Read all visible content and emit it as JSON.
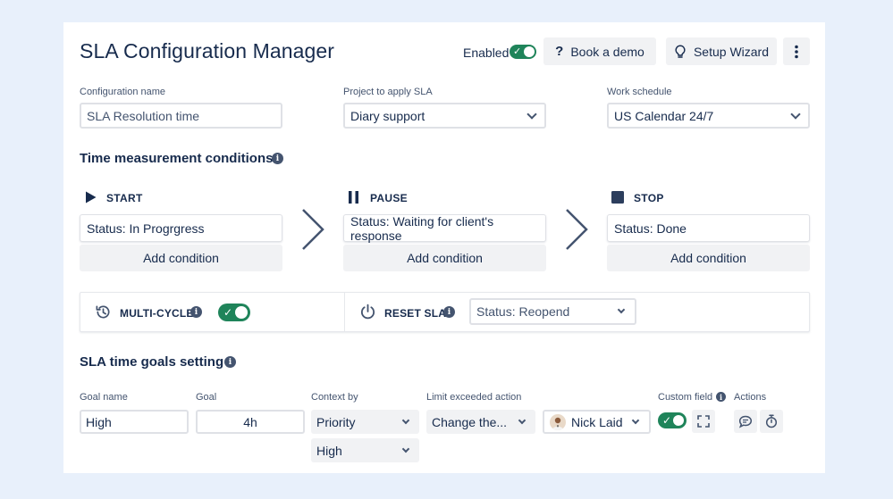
{
  "header": {
    "title": "SLA Configuration Manager",
    "enabled_label": "Enabled",
    "enabled": true,
    "book_demo": "Book a demo",
    "setup_wizard": "Setup Wizard"
  },
  "config": {
    "name_label": "Configuration name",
    "name_placeholder": "SLA Resolution time",
    "project_label": "Project to apply SLA",
    "project_value": "Diary support",
    "schedule_label": "Work schedule",
    "schedule_value": "US Calendar 24/7"
  },
  "conditions": {
    "title": "Time measurement conditions",
    "start": {
      "label": "START",
      "value": "Status: In Progrgress",
      "add": "Add condition"
    },
    "pause": {
      "label": "PAUSE",
      "value": "Status: Waiting for client's response",
      "add": "Add condition"
    },
    "stop": {
      "label": "STOP",
      "value": "Status: Done",
      "add": "Add condition"
    }
  },
  "multi_cycle": {
    "label": "MULTI-CYCLE",
    "enabled": true
  },
  "reset_sla": {
    "label": "RESET SLA",
    "value": "Status: Reopend"
  },
  "goals": {
    "title": "SLA time goals setting",
    "headers": {
      "goal_name": "Goal name",
      "goal": "Goal",
      "context_by": "Context by",
      "limit_action": "Limit exceeded action",
      "custom_field": "Custom field",
      "actions": "Actions"
    },
    "row": {
      "goal_name": "High",
      "goal": "4h",
      "context": "Priority",
      "context_value": "High",
      "action": "Change the...",
      "assignee": "Nick Laid",
      "custom_field_enabled": true
    }
  },
  "colors": {
    "toggle_on": "#1f845a",
    "text": "#172b4d",
    "background": "#e8f0fb"
  }
}
